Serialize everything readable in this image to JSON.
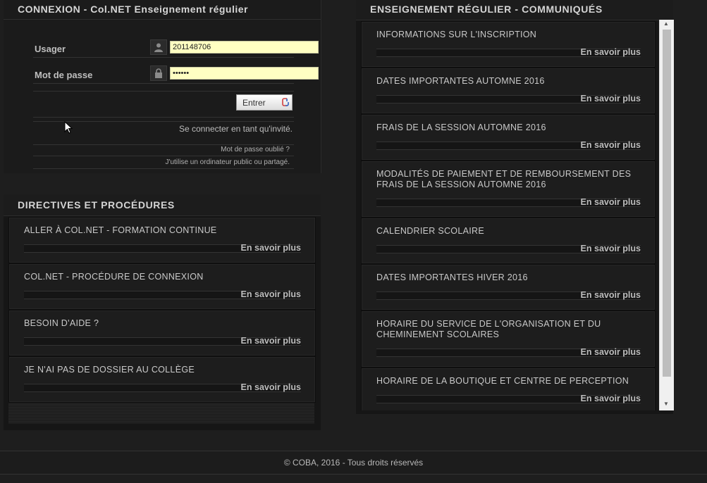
{
  "login": {
    "title": "CONNEXION - Col.NET Enseignement régulier",
    "username_label": "Usager",
    "username_value": "201148706",
    "password_label": "Mot de passe",
    "password_value": "••••••",
    "enter_label": "Entrer",
    "guest_link": "Se connecter en tant qu'invité.",
    "forgot_link": "Mot de passe oublié ?",
    "public_link": "J'utilise un ordinateur public ou partagé."
  },
  "directives": {
    "title": "DIRECTIVES ET PROCÉDURES",
    "more_label": "En savoir plus",
    "items": [
      {
        "title": "ALLER À COL.NET - FORMATION CONTINUE"
      },
      {
        "title": "COL.NET - PROCÉDURE DE CONNEXION"
      },
      {
        "title": "BESOIN D'AIDE ?"
      },
      {
        "title": "JE N'AI PAS DE DOSSIER AU COLLÈGE"
      }
    ]
  },
  "communiques": {
    "title": "ENSEIGNEMENT RÉGULIER - COMMUNIQUÉS",
    "more_label": "En savoir plus",
    "items": [
      {
        "title": "INFORMATIONS SUR L'INSCRIPTION"
      },
      {
        "title": "DATES IMPORTANTES AUTOMNE 2016"
      },
      {
        "title": "FRAIS DE LA SESSION AUTOMNE 2016"
      },
      {
        "title": "MODALITÉS DE PAIEMENT ET DE REMBOURSEMENT DES FRAIS DE LA SESSION AUTOMNE 2016"
      },
      {
        "title": "CALENDRIER SCOLAIRE"
      },
      {
        "title": "DATES IMPORTANTES HIVER 2016"
      },
      {
        "title": "HORAIRE DU SERVICE DE L'ORGANISATION ET DU CHEMINEMENT SCOLAIRES"
      },
      {
        "title": "HORAIRE DE LA BOUTIQUE ET CENTRE DE PERCEPTION"
      }
    ]
  },
  "footer": {
    "copyright": "© COBA, 2016 - Tous droits réservés"
  }
}
